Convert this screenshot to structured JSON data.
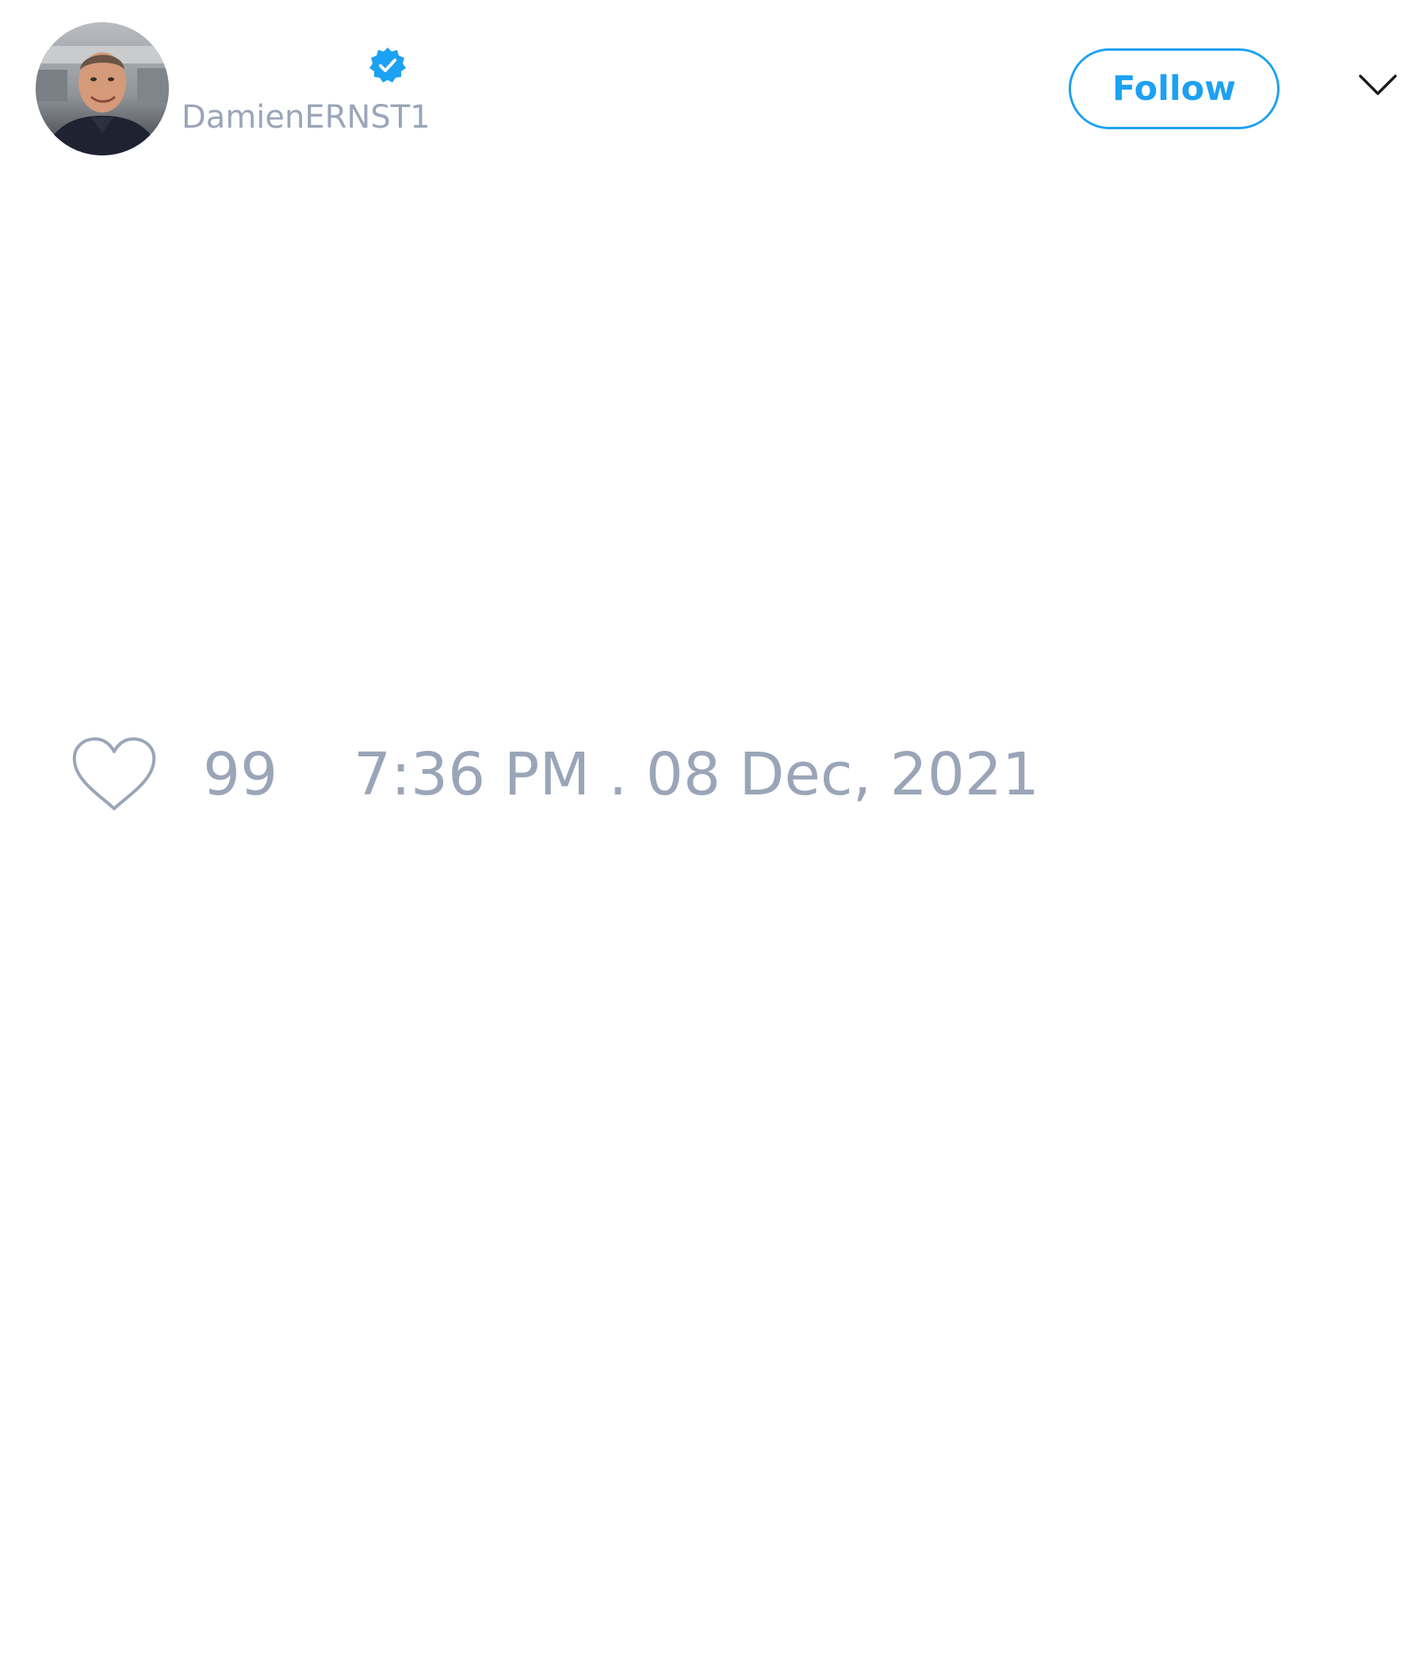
{
  "tweet": {
    "author": {
      "handle": "DamienERNST1",
      "verified": true
    },
    "follow_label": "Follow",
    "likes_count": "99",
    "timestamp": "7:36 PM . 08 Dec, 2021"
  },
  "colors": {
    "accent": "#1da1f2",
    "muted_text": "#9aa5b8",
    "background": "#ffffff"
  },
  "icons": {
    "verified": "verified-badge-icon",
    "more": "chevron-down-icon",
    "like": "heart-icon"
  }
}
